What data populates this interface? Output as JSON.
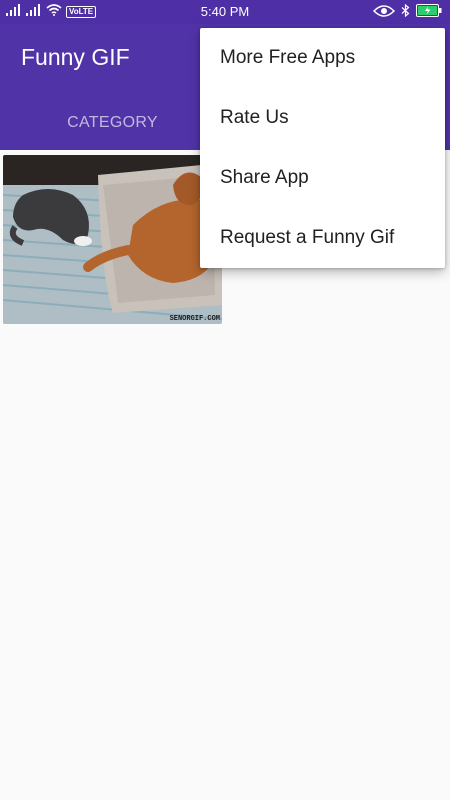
{
  "status_bar": {
    "time": "5:40 PM",
    "volte": "VoLTE"
  },
  "app_bar": {
    "title": "Funny GIF",
    "tabs": [
      {
        "label": "CATEGORY"
      }
    ]
  },
  "gif": {
    "watermark": "SENORGIF.COM"
  },
  "overflow_menu": {
    "items": [
      {
        "label": "More Free Apps"
      },
      {
        "label": "Rate Us"
      },
      {
        "label": "Share App"
      },
      {
        "label": "Request a Funny Gif"
      }
    ]
  }
}
